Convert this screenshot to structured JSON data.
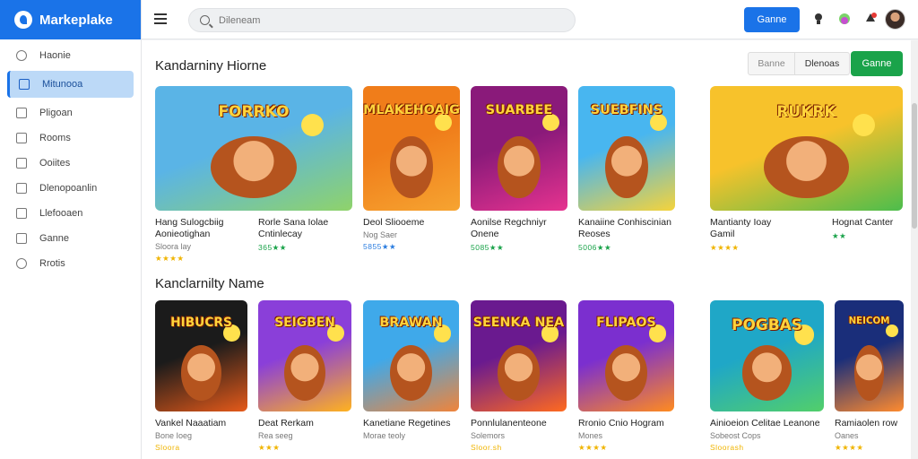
{
  "brand": {
    "name": "Markeplake"
  },
  "sidebar": {
    "items": [
      {
        "label": "Haonie"
      },
      {
        "label": "Mitunooa"
      },
      {
        "label": "Pligoan"
      },
      {
        "label": "Rooms"
      },
      {
        "label": "Ooiites"
      },
      {
        "label": "Dlenopoanlin"
      },
      {
        "label": "Llefooaen"
      },
      {
        "label": "Ganne"
      },
      {
        "label": "Rrotis"
      }
    ]
  },
  "topbar": {
    "search_placeholder": "Dileneam",
    "button": "Ganne"
  },
  "section1": {
    "title": "Kandarniny Hiorne",
    "filters": [
      "Banne",
      "Dlenoas"
    ],
    "game_button": "Ganne",
    "cards": [
      {
        "title": "Hang Sulogcbiig",
        "title2": "Aonieotighan",
        "sub": "Sloora lay",
        "rating": "★★★★",
        "rating_color": "gold",
        "thumb_text": "FORRKO",
        "colors": [
          "#5ab4e6",
          "#8fd36a"
        ]
      },
      {
        "title": "Rorle Sana Iolae",
        "title2": "Cntinlecay",
        "sub": "",
        "rating": "365★★",
        "rating_color": "green",
        "thumb_text": "",
        "colors": [
          "#9bd26b",
          "#e24b2b"
        ]
      },
      {
        "title": "Deol Sliooeme",
        "title2": "",
        "sub": "Nog Saer",
        "rating": "5855★★",
        "rating_color": "blue",
        "thumb_text": "MLAKEHOAIG",
        "colors": [
          "#f07d1a",
          "#f6a431"
        ]
      },
      {
        "title": "Aonilse Regchniyr",
        "title2": "Onene",
        "sub": "",
        "rating": "5085★★",
        "rating_color": "green",
        "thumb_text": "SUARBEE",
        "colors": [
          "#8a1a7a",
          "#e6338f"
        ]
      },
      {
        "title": "Kanaiine Conhiscinian",
        "title2": "Reoses",
        "sub": "",
        "rating": "5006★★",
        "rating_color": "green",
        "thumb_text": "SUEBFINS",
        "colors": [
          "#48b6f0",
          "#f5d33b"
        ]
      },
      {
        "title": "Mantianty Ioay",
        "title2": "Gamil",
        "sub": "",
        "rating": "★★★★",
        "rating_color": "gold",
        "thumb_text": "RUKRK",
        "colors": [
          "#f7c22b",
          "#4cbd4c"
        ]
      },
      {
        "title": "Hognat Canter",
        "title2": "",
        "sub": "",
        "rating": "★★",
        "rating_color": "green",
        "thumb_text": "",
        "colors": [],
        "hide_thumb": true
      }
    ]
  },
  "section2": {
    "title": "Kanclarnilty Name",
    "cards": [
      {
        "title": "Vankel Naaatiam",
        "sub": "Bone Ioeg",
        "rating": "Sloora",
        "thumb_text": "HIBUCRS",
        "colors": [
          "#1b1b1b",
          "#e65a1a"
        ]
      },
      {
        "title": "Deat Rerkam",
        "sub": "Rea seeg",
        "rating": "★★★",
        "thumb_text": "SEIGBEN",
        "colors": [
          "#8a3fd9",
          "#ffb21f"
        ]
      },
      {
        "title": "Kanetiane Regetines",
        "sub": "Morae teoly",
        "rating": "",
        "thumb_text": "BRAWAN",
        "colors": [
          "#3fa9ea",
          "#f0843a"
        ]
      },
      {
        "title": "Ponnlulanenteone",
        "sub": "Solemors",
        "rating": "Sloor.sh",
        "thumb_text": "SEENKA NEA",
        "colors": [
          "#6a1a8f",
          "#ff6a1f"
        ]
      },
      {
        "title": "Rronio Cnio Hogram",
        "sub": "Mones",
        "rating": "★★★★",
        "thumb_text": "FLIPAOS",
        "colors": [
          "#7b2fcf",
          "#ff8b1f"
        ]
      },
      {
        "title": "Ainioeion Celitae Leanone",
        "sub": "Sobeost Cops",
        "rating": "Sloorash",
        "thumb_text": "POGBAS",
        "colors": [
          "#1fa7c7",
          "#52cf6a"
        ]
      },
      {
        "title": "Ramiaolen row",
        "sub": "Oanes",
        "rating": "★★★★",
        "thumb_text": "NEICOM",
        "colors": [
          "#1a2e7a",
          "#ff8b2f"
        ]
      }
    ]
  }
}
